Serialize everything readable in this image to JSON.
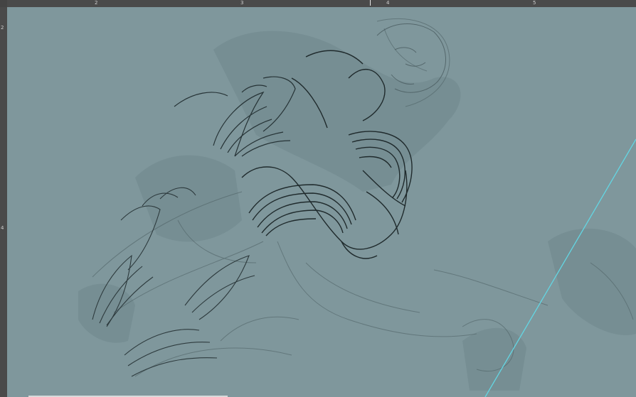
{
  "ruler": {
    "top_labels": [
      "2",
      "3",
      "4",
      "5"
    ],
    "left_labels": [
      "2",
      "4"
    ]
  },
  "canvas": {
    "background": "#7f979c",
    "guide_color": "#63d6e3",
    "line_color": "#1f2a2c"
  }
}
